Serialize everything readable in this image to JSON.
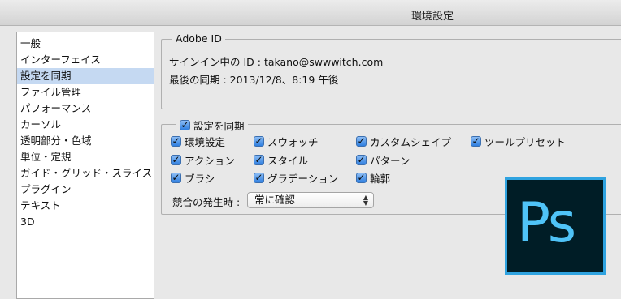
{
  "window": {
    "title": "環境設定"
  },
  "sidebar": {
    "items": [
      {
        "label": "一般",
        "selected": false
      },
      {
        "label": "インターフェイス",
        "selected": false
      },
      {
        "label": "設定を同期",
        "selected": true
      },
      {
        "label": "ファイル管理",
        "selected": false
      },
      {
        "label": "パフォーマンス",
        "selected": false
      },
      {
        "label": "カーソル",
        "selected": false
      },
      {
        "label": "透明部分・色域",
        "selected": false
      },
      {
        "label": "単位・定規",
        "selected": false
      },
      {
        "label": "ガイド・グリッド・スライス",
        "selected": false
      },
      {
        "label": "プラグイン",
        "selected": false
      },
      {
        "label": "テキスト",
        "selected": false
      },
      {
        "label": "3D",
        "selected": false
      }
    ]
  },
  "adobe_id": {
    "legend": "Adobe ID",
    "signed_in": "サインイン中の ID : takano@swwwitch.com",
    "last_sync": "最後の同期 : 2013/12/8、8:19 午後"
  },
  "sync": {
    "legend": "設定を同期",
    "legend_checked": true,
    "options": [
      {
        "label": "環境設定",
        "checked": true
      },
      {
        "label": "スウォッチ",
        "checked": true
      },
      {
        "label": "カスタムシェイプ",
        "checked": true
      },
      {
        "label": "ツールプリセット",
        "checked": true
      },
      {
        "label": "アクション",
        "checked": true
      },
      {
        "label": "スタイル",
        "checked": true
      },
      {
        "label": "パターン",
        "checked": true
      },
      {
        "label": "ブラシ",
        "checked": true
      },
      {
        "label": "グラデーション",
        "checked": true
      },
      {
        "label": "輪郭",
        "checked": true
      }
    ],
    "conflict_label": "競合の発生時 :",
    "conflict_value": "常に確認"
  },
  "logo": {
    "text": "Ps"
  },
  "colors": {
    "selection": "#c5d9f2",
    "logo_bg": "#001d26",
    "logo_accent": "#2fa3e0"
  }
}
